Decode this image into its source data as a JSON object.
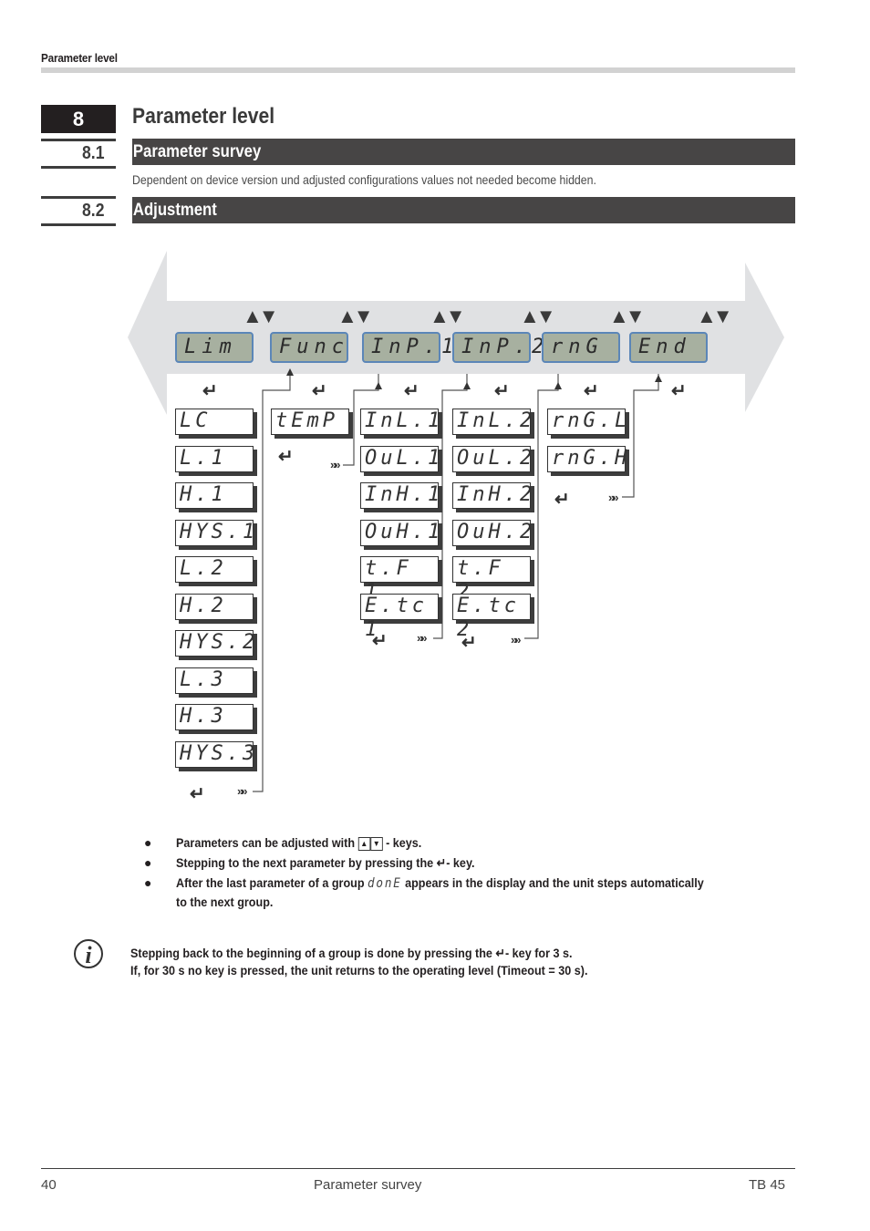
{
  "running_head": "Parameter level",
  "section": {
    "number": "8",
    "title": "Parameter level"
  },
  "subsections": [
    {
      "number": "8.1",
      "title": "Parameter survey",
      "text": "Dependent on device version und adjusted configurations values not needed become hidden."
    },
    {
      "number": "8.2",
      "title": "Adjustment"
    }
  ],
  "diagram": {
    "colors": {
      "lcd_bg": "#a7b0a0",
      "lcd_border": "#5b86b8",
      "band": "#e0e1e3",
      "dark": "#3d3d3d"
    },
    "updown_symbol": "▲▼",
    "enter_symbol": "↵",
    "next_symbol": "»",
    "groups": [
      {
        "display": "Lim",
        "params": [
          "LC",
          "L.1",
          "H.1",
          "HYS.1",
          "L.2",
          "H.2",
          "HYS.2",
          "L.3",
          "H.3",
          "HYS.3"
        ]
      },
      {
        "display": "Func",
        "params": [
          "tEmP"
        ]
      },
      {
        "display": "InP.1",
        "params": [
          "InL.1",
          "OuL.1",
          "InH.1",
          "OuH.1",
          "t.F 1",
          "E.tc 1"
        ]
      },
      {
        "display": "InP.2",
        "params": [
          "InL.2",
          "OuL.2",
          "InH.2",
          "OuH.2",
          "t.F 2",
          "E.tc 2"
        ]
      },
      {
        "display": "rnG",
        "params": [
          "rnG.L",
          "rnG.H"
        ]
      },
      {
        "display": "End",
        "params": []
      }
    ]
  },
  "bullets": [
    {
      "before": "Parameters can be adjusted with",
      "keys": [
        "▲",
        "▼"
      ],
      "after": "- keys."
    },
    {
      "before": "Stepping to the next parameter by pressing the",
      "key": "↵",
      "after": "- key."
    },
    {
      "before": "After the last parameter of a group",
      "lcd": "donE",
      "after": "appears in the display and the unit steps automatically",
      "line2": "to the next group."
    }
  ],
  "note": {
    "icon": "info-icon",
    "line1": "Stepping back to the beginning of a group is done by pressing the ↵- key  for 3 s.",
    "line2": "If, for 30 s no key is pressed, the unit returns to the operating level (Timeout = 30 s)."
  },
  "footer": {
    "page": "40",
    "center": "Parameter survey",
    "right": "TB 45"
  }
}
